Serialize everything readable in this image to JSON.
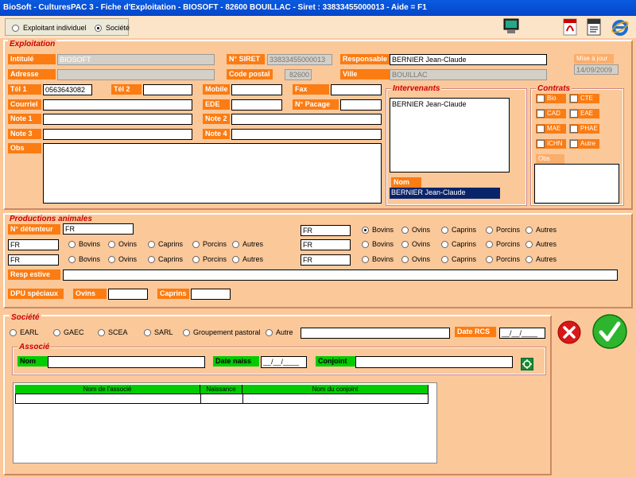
{
  "window": {
    "title": "BioSoft - CulturesPAC 3 - Fiche d'Exploitation      - BIOSOFT - 82600 BOUILLAC - Siret : 33833455000013 - Aide = F1"
  },
  "topbar": {
    "type_individuel": "Exploitant individuel",
    "type_societe": "Société"
  },
  "exploitation": {
    "legend": "Exploitation",
    "intitule_label": "Intitulé",
    "intitule_value": "BIOSOFT",
    "siret_label": "N° SIRET",
    "siret_value": "33833455000013",
    "responsable_label": "Responsable",
    "responsable_value": "BERNIER Jean-Claude",
    "mise_a_jour_label": "Mise à jour",
    "mise_a_jour_value": "14/09/2009",
    "adresse_label": "Adresse",
    "adresse_value": "",
    "code_postal_label": "Code postal",
    "code_postal_value": "82600",
    "ville_label": "Ville",
    "ville_value": "BOUILLAC",
    "tel1_label": "Tél 1",
    "tel1_value": "0563643082",
    "tel2_label": "Tél 2",
    "tel2_value": "",
    "mobile_label": "Mobile",
    "mobile_value": "",
    "fax_label": "Fax",
    "fax_value": "",
    "courriel_label": "Courriel",
    "courriel_value": "",
    "ede_label": "EDE",
    "ede_value": "",
    "pacage_label": "N° Pacage",
    "pacage_value": "",
    "note1_label": "Note 1",
    "note2_label": "Note 2",
    "note3_label": "Note 3",
    "note4_label": "Note 4",
    "obs_label": "Obs"
  },
  "intervenants": {
    "legend": "Intervenants",
    "list": [
      "BERNIER Jean-Claude"
    ],
    "nom_label": "Nom",
    "nom_value": "BERNIER Jean-Claude"
  },
  "contrats": {
    "legend": "Contrats",
    "items": [
      "Bio",
      "CTE",
      "CAD",
      "EAE",
      "MAE",
      "PHAE",
      "ICHN",
      "Autre"
    ],
    "obs_label": "Obs"
  },
  "productions": {
    "legend": "Productions animales",
    "detenteur_label": "N° détenteur",
    "fr": "FR",
    "species": [
      "Bovins",
      "Ovins",
      "Caprins",
      "Porcins",
      "Autres"
    ],
    "resp_estive_label": "Resp estive",
    "dpu_label": "DPU spéciaux",
    "ovins_label": "Ovins",
    "caprins_label": "Caprins"
  },
  "societe": {
    "legend": "Société",
    "forms": [
      "EARL",
      "GAEC",
      "SCEA",
      "SARL",
      "Groupement pastoral",
      "Autre"
    ],
    "date_rcs_label": "Date RCS",
    "date_rcs_value": "__/__/____",
    "associe_legend": "Associé",
    "nom_label": "Nom",
    "date_naiss_label": "Date naiss",
    "date_naiss_value": "__/__/____",
    "conjoint_label": "Conjoint",
    "grid_headers": [
      "Nom de l'associé",
      "Naissance",
      "Nom du conjoint"
    ]
  },
  "icons": {
    "accent": "#fb7c13",
    "title_blue": "#0545c8"
  }
}
